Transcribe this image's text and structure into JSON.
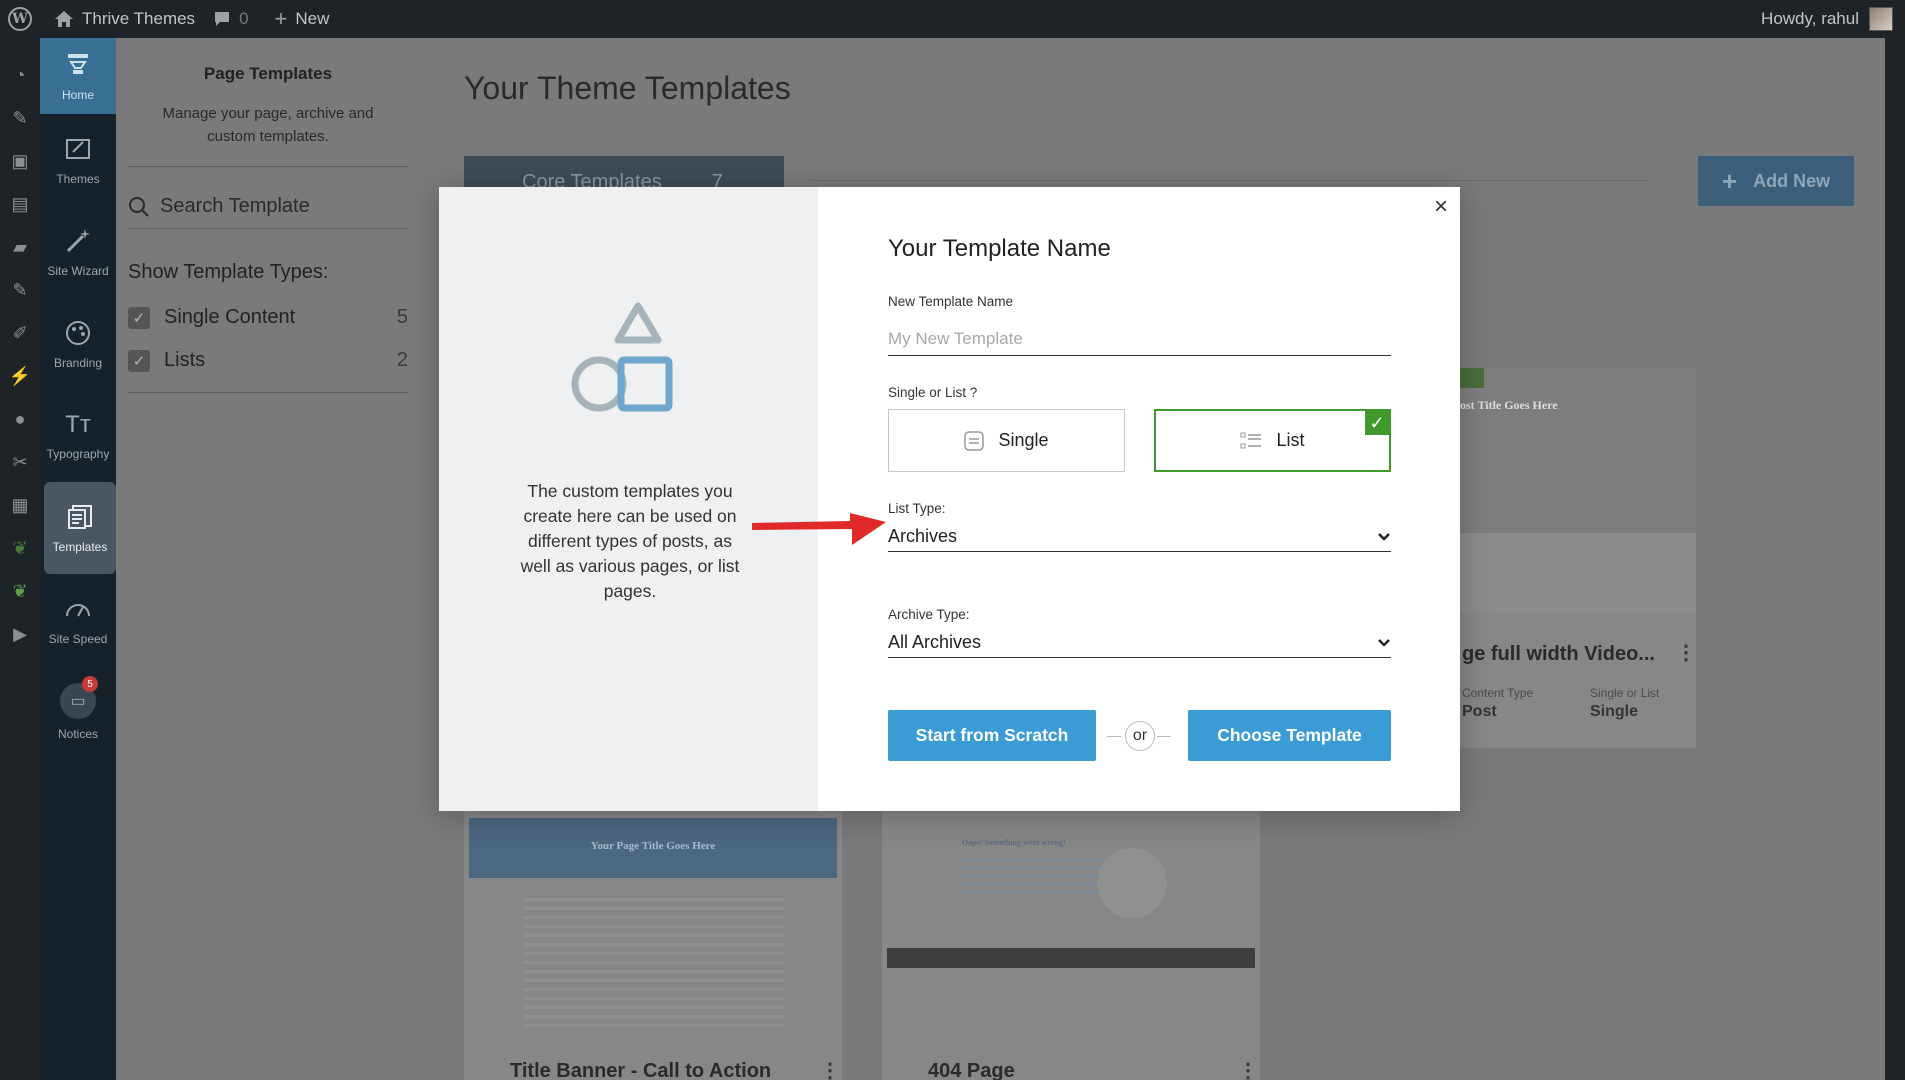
{
  "adminbar": {
    "site_name": "Thrive Themes",
    "comments_count": "0",
    "new_label": "New",
    "howdy": "Howdy, rahul"
  },
  "thrive_nav": {
    "home": "Home",
    "themes": "Themes",
    "site_wizard": "Site Wizard",
    "branding": "Branding",
    "typography": "Typography",
    "templates": "Templates",
    "site_speed": "Site Speed",
    "notices": "Notices",
    "notices_count": "5"
  },
  "panel": {
    "title": "Page Templates",
    "description": "Manage your page, archive and custom templates.",
    "search_placeholder": "Search Template",
    "types_heading": "Show Template Types:",
    "types": [
      {
        "label": "Single Content",
        "count": "5"
      },
      {
        "label": "Lists",
        "count": "2"
      }
    ]
  },
  "main": {
    "title": "Your Theme Templates",
    "core_templates": "Core Templates",
    "core_count": "7",
    "add_new": "Add New",
    "cards": [
      {
        "title": "ge full width Video...",
        "meta_left_label": "Content Type",
        "meta_left_value": "Post",
        "meta_right_label": "Single or List",
        "meta_right_value": "Single",
        "thumb_heading": "ost Title Goes Here"
      },
      {
        "title": "Title Banner - Call to Action",
        "thumb_heading": "Your Page Title Goes Here"
      },
      {
        "title": "404 Page",
        "thumb_heading": "Oops! Something went wrong!"
      }
    ]
  },
  "modal": {
    "close": "×",
    "info": "The custom templates you create here can be used on different types of posts, as well as various pages, or list pages.",
    "heading": "Your Template Name",
    "name_label": "New Template Name",
    "name_placeholder": "My New Template",
    "single_or_list_label": "Single or List ?",
    "single": "Single",
    "list": "List",
    "list_type_label": "List Type:",
    "list_type_value": "Archives",
    "archive_type_label": "Archive Type:",
    "archive_type_value": "All Archives",
    "start_scratch": "Start from Scratch",
    "or": "or",
    "choose_template": "Choose Template"
  },
  "colors": {
    "accent_blue": "#3b9bd5",
    "selected_green": "#3f9a2b",
    "arrow_red": "#e02a2a"
  }
}
